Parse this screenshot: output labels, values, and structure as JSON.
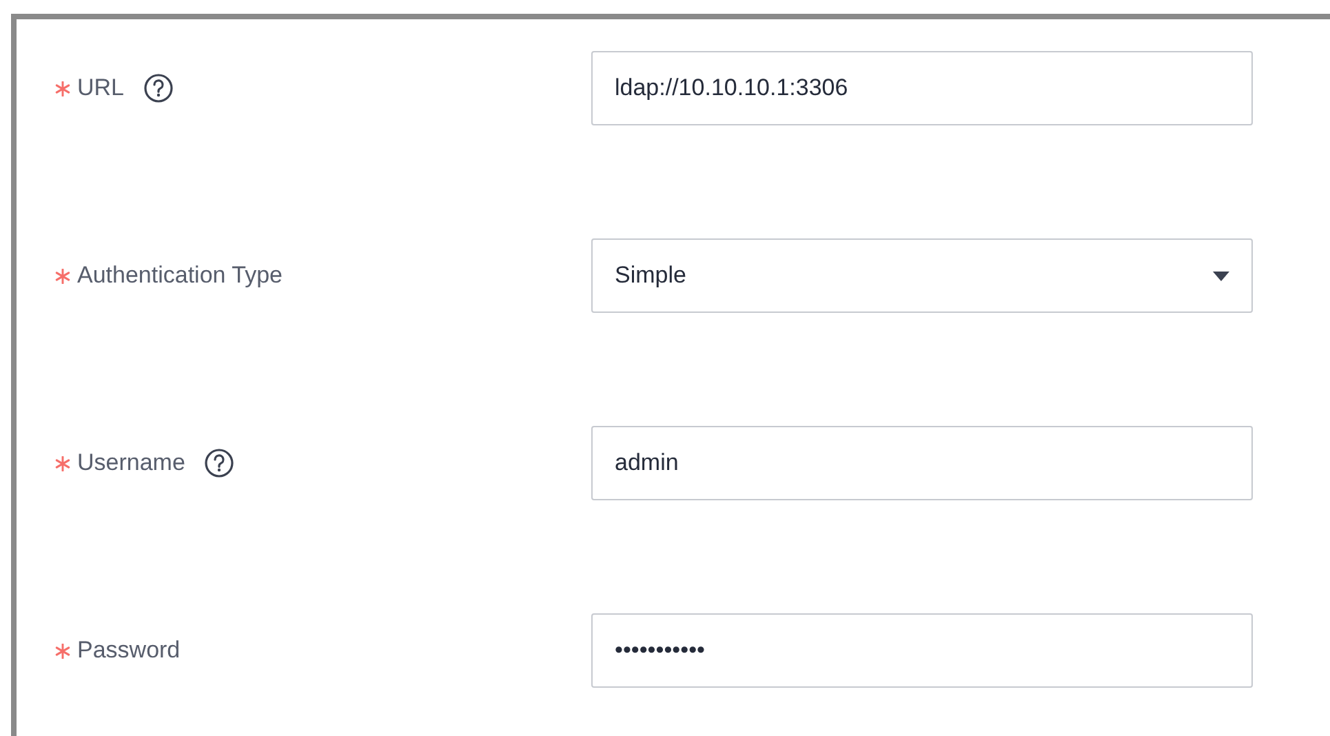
{
  "fields": [
    {
      "label": "URL",
      "required": true,
      "help": true,
      "kind": "text",
      "value": "ldap://10.10.10.1:3306"
    },
    {
      "label": "Authentication Type",
      "required": true,
      "help": false,
      "kind": "select",
      "value": "Simple"
    },
    {
      "label": "Username",
      "required": true,
      "help": true,
      "kind": "text",
      "value": "admin"
    },
    {
      "label": "Password",
      "required": true,
      "help": false,
      "kind": "password",
      "value": "•••••••••••"
    }
  ]
}
